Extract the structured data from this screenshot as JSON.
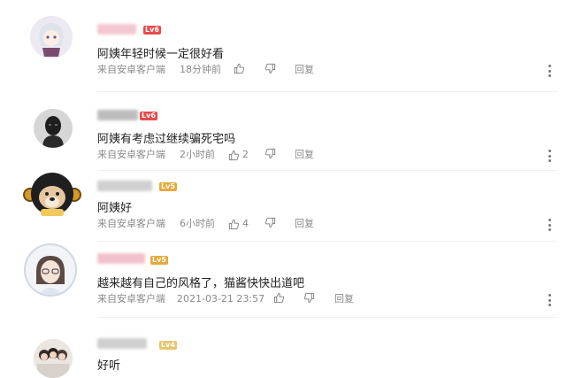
{
  "comments": [
    {
      "level": "Lv6",
      "text": "阿姨年轻时候一定很好看",
      "source": "来自安卓客户端",
      "time": "18分钟前",
      "likes": "",
      "reply": "回复",
      "avatar_icon": "anime-girl-avatar",
      "level_color": "#e84b4b"
    },
    {
      "level": "Lv6",
      "text": "阿姨有考虑过继续骗死宅吗",
      "source": "来自安卓客户端",
      "time": "2小时前",
      "likes": "2",
      "reply": "回复",
      "avatar_icon": "masked-figure-avatar",
      "level_color": "#e84b4b"
    },
    {
      "level": "Lv5",
      "text": "阿姨好",
      "source": "来自安卓客户端",
      "time": "6小时前",
      "likes": "4",
      "reply": "回复",
      "avatar_icon": "dog-avatar",
      "level_color": "#e8a83c"
    },
    {
      "level": "Lv5",
      "text": "越来越有自己的风格了，猫酱快快出道吧",
      "source": "来自安卓客户端",
      "time": "2021-03-21 23:57",
      "likes": "",
      "reply": "回复",
      "avatar_icon": "girl-photo-avatar",
      "level_color": "#e8a83c"
    },
    {
      "level": "Lv4",
      "text": "好听",
      "avatar_icon": "group-photo-avatar",
      "level_color": "#e8c46a"
    }
  ]
}
